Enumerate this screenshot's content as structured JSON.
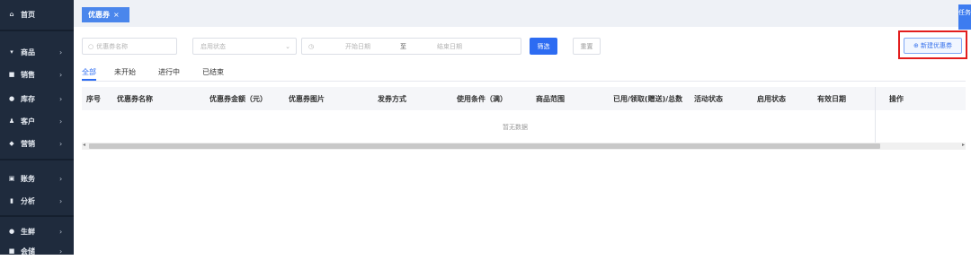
{
  "sidebar": {
    "items": [
      {
        "label": "首页",
        "icon": "home-icon",
        "glyph": "⌂",
        "chevron": ""
      },
      {
        "label": "商品",
        "icon": "cart-icon",
        "glyph": "▾",
        "chevron": "›"
      },
      {
        "label": "销售",
        "icon": "sales-icon",
        "glyph": "■",
        "chevron": "›"
      },
      {
        "label": "库存",
        "icon": "stock-icon",
        "glyph": "●",
        "chevron": "›"
      },
      {
        "label": "客户",
        "icon": "customer-icon",
        "glyph": "♟",
        "chevron": "›"
      },
      {
        "label": "营销",
        "icon": "marketing-icon",
        "glyph": "◆",
        "chevron": "›"
      },
      {
        "label": "账务",
        "icon": "account-icon",
        "glyph": "▣",
        "chevron": "›"
      },
      {
        "label": "分析",
        "icon": "chart-icon",
        "glyph": "▮",
        "chevron": "›"
      },
      {
        "label": "生鲜",
        "icon": "fresh-icon",
        "glyph": "●",
        "chevron": "›"
      },
      {
        "label": "会储",
        "icon": "store-icon",
        "glyph": "■",
        "chevron": "›"
      }
    ]
  },
  "tabbar": {
    "active_tab": "优惠券",
    "close": "×",
    "task_label": "任务"
  },
  "filters": {
    "name_placeholder": "优惠券名称",
    "status_placeholder": "启用状态",
    "start_placeholder": "开始日期",
    "to": "至",
    "end_placeholder": "结束日期",
    "search_label": "筛选",
    "reset_label": "重置",
    "new_label": "⊕ 新建优惠券"
  },
  "subtabs": [
    "全部",
    "未开始",
    "进行中",
    "已结束"
  ],
  "table": {
    "headers": [
      "序号",
      "优惠券名称",
      "优惠券金额（元）",
      "优惠券图片",
      "发券方式",
      "使用条件（满）",
      "商品范围",
      "已用/领取(赠送)/总数",
      "活动状态",
      "启用状态",
      "有效日期",
      "操作"
    ],
    "empty_text": "暂无数据"
  },
  "colors": {
    "sidebar": "#1f2b3d",
    "accent": "#2d6cf2",
    "highlight": "#e21d1d"
  }
}
